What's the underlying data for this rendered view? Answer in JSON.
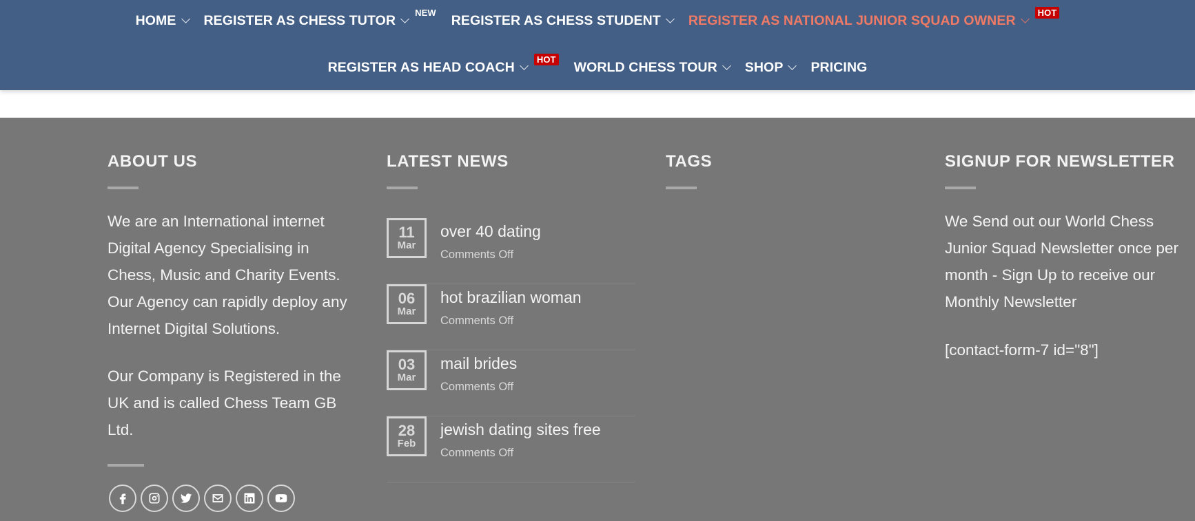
{
  "nav": {
    "row1": [
      {
        "label": "HOME",
        "chevron": true
      },
      {
        "label": "REGISTER AS CHESS TUTOR",
        "chevron": true,
        "badge": "NEW"
      },
      {
        "label": "REGISTER AS CHESS STUDENT",
        "chevron": true
      },
      {
        "label": "REGISTER AS NATIONAL JUNIOR SQUAD OWNER",
        "chevron": true,
        "badge": "HOT",
        "active": true
      }
    ],
    "row2": [
      {
        "label": "REGISTER AS HEAD COACH",
        "chevron": true,
        "badge": "HOT"
      },
      {
        "label": "WORLD CHESS TOUR",
        "chevron": true
      },
      {
        "label": "SHOP",
        "chevron": true
      },
      {
        "label": "PRICING",
        "chevron": false
      }
    ]
  },
  "colors": {
    "nav_bg": "#435f86",
    "active": "#ef7a66",
    "hot_badge": "#c70000",
    "footer_bg": "#777777"
  },
  "about": {
    "title": "ABOUT US",
    "p1": "We are an International internet Digital Agency Specialising in Chess, Music and Charity Events. Our Agency can rapidly deploy any Internet Digital Solutions.",
    "p2": "Our Company is Registered in the UK  and is called Chess Team GB Ltd.",
    "socials": [
      "facebook-icon",
      "instagram-icon",
      "twitter-icon",
      "email-icon",
      "linkedin-icon",
      "youtube-icon"
    ]
  },
  "news": {
    "title": "LATEST NEWS",
    "items": [
      {
        "day": "11",
        "month": "Mar",
        "title": "over 40 dating",
        "meta": "Comments Off"
      },
      {
        "day": "06",
        "month": "Mar",
        "title": "hot brazilian woman",
        "meta": "Comments Off"
      },
      {
        "day": "03",
        "month": "Mar",
        "title": "mail brides",
        "meta": "Comments Off"
      },
      {
        "day": "28",
        "month": "Feb",
        "title": "jewish dating sites free",
        "meta": "Comments Off"
      }
    ]
  },
  "tags": {
    "title": "TAGS"
  },
  "newsletter": {
    "title": "SIGNUP FOR NEWSLETTER",
    "p1": "We Send out our World Chess Junior Squad Newsletter once per month - Sign Up to receive our Monthly Newsletter",
    "p2": "[contact-form-7 id=\"8\"]"
  }
}
